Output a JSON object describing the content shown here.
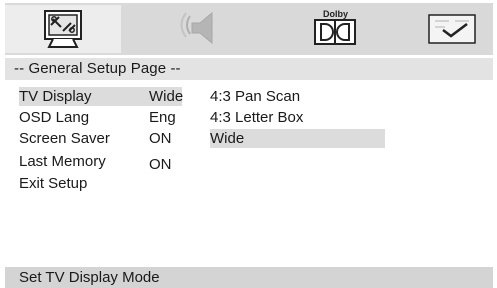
{
  "tabs": {
    "general": {
      "icon": "tv-wrench-icon"
    },
    "audio": {
      "icon": "speaker-icon"
    },
    "dolby": {
      "icon": "dolby-icon",
      "text": "Dolby"
    },
    "preference": {
      "icon": "checkmark-icon"
    }
  },
  "page_title": "-- General Setup Page --",
  "menu": [
    {
      "label": "TV Display",
      "value": "Wide"
    },
    {
      "label": "OSD Lang",
      "value": "Eng"
    },
    {
      "label": "Screen Saver",
      "value": "ON"
    },
    {
      "label": "Last Memory",
      "value": "ON"
    },
    {
      "label": "Exit Setup",
      "value": ""
    }
  ],
  "options": [
    "4:3 Pan Scan",
    "4:3 Letter Box",
    "Wide"
  ],
  "status": "Set TV Display Mode",
  "colors": {
    "tab_bar": "#d9d9d9",
    "highlight": "#dcdcdc",
    "status_bar": "#d4d4d4"
  }
}
